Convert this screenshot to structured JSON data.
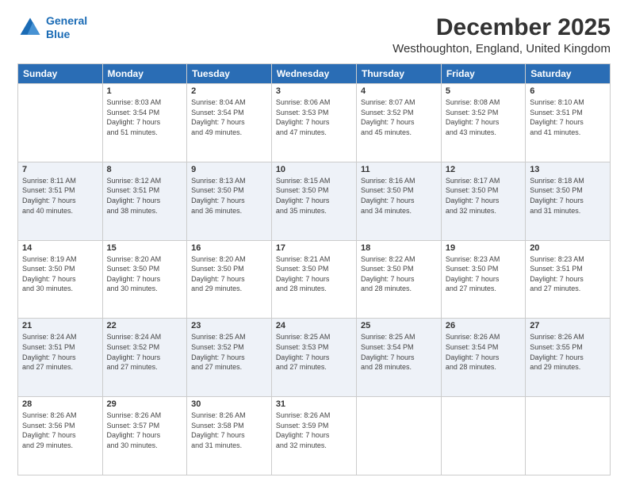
{
  "logo": {
    "line1": "General",
    "line2": "Blue"
  },
  "title": "December 2025",
  "subtitle": "Westhoughton, England, United Kingdom",
  "days_of_week": [
    "Sunday",
    "Monday",
    "Tuesday",
    "Wednesday",
    "Thursday",
    "Friday",
    "Saturday"
  ],
  "weeks": [
    [
      {
        "day": "",
        "info": ""
      },
      {
        "day": "1",
        "info": "Sunrise: 8:03 AM\nSunset: 3:54 PM\nDaylight: 7 hours\nand 51 minutes."
      },
      {
        "day": "2",
        "info": "Sunrise: 8:04 AM\nSunset: 3:54 PM\nDaylight: 7 hours\nand 49 minutes."
      },
      {
        "day": "3",
        "info": "Sunrise: 8:06 AM\nSunset: 3:53 PM\nDaylight: 7 hours\nand 47 minutes."
      },
      {
        "day": "4",
        "info": "Sunrise: 8:07 AM\nSunset: 3:52 PM\nDaylight: 7 hours\nand 45 minutes."
      },
      {
        "day": "5",
        "info": "Sunrise: 8:08 AM\nSunset: 3:52 PM\nDaylight: 7 hours\nand 43 minutes."
      },
      {
        "day": "6",
        "info": "Sunrise: 8:10 AM\nSunset: 3:51 PM\nDaylight: 7 hours\nand 41 minutes."
      }
    ],
    [
      {
        "day": "7",
        "info": "Sunrise: 8:11 AM\nSunset: 3:51 PM\nDaylight: 7 hours\nand 40 minutes."
      },
      {
        "day": "8",
        "info": "Sunrise: 8:12 AM\nSunset: 3:51 PM\nDaylight: 7 hours\nand 38 minutes."
      },
      {
        "day": "9",
        "info": "Sunrise: 8:13 AM\nSunset: 3:50 PM\nDaylight: 7 hours\nand 36 minutes."
      },
      {
        "day": "10",
        "info": "Sunrise: 8:15 AM\nSunset: 3:50 PM\nDaylight: 7 hours\nand 35 minutes."
      },
      {
        "day": "11",
        "info": "Sunrise: 8:16 AM\nSunset: 3:50 PM\nDaylight: 7 hours\nand 34 minutes."
      },
      {
        "day": "12",
        "info": "Sunrise: 8:17 AM\nSunset: 3:50 PM\nDaylight: 7 hours\nand 32 minutes."
      },
      {
        "day": "13",
        "info": "Sunrise: 8:18 AM\nSunset: 3:50 PM\nDaylight: 7 hours\nand 31 minutes."
      }
    ],
    [
      {
        "day": "14",
        "info": "Sunrise: 8:19 AM\nSunset: 3:50 PM\nDaylight: 7 hours\nand 30 minutes."
      },
      {
        "day": "15",
        "info": "Sunrise: 8:20 AM\nSunset: 3:50 PM\nDaylight: 7 hours\nand 30 minutes."
      },
      {
        "day": "16",
        "info": "Sunrise: 8:20 AM\nSunset: 3:50 PM\nDaylight: 7 hours\nand 29 minutes."
      },
      {
        "day": "17",
        "info": "Sunrise: 8:21 AM\nSunset: 3:50 PM\nDaylight: 7 hours\nand 28 minutes."
      },
      {
        "day": "18",
        "info": "Sunrise: 8:22 AM\nSunset: 3:50 PM\nDaylight: 7 hours\nand 28 minutes."
      },
      {
        "day": "19",
        "info": "Sunrise: 8:23 AM\nSunset: 3:50 PM\nDaylight: 7 hours\nand 27 minutes."
      },
      {
        "day": "20",
        "info": "Sunrise: 8:23 AM\nSunset: 3:51 PM\nDaylight: 7 hours\nand 27 minutes."
      }
    ],
    [
      {
        "day": "21",
        "info": "Sunrise: 8:24 AM\nSunset: 3:51 PM\nDaylight: 7 hours\nand 27 minutes."
      },
      {
        "day": "22",
        "info": "Sunrise: 8:24 AM\nSunset: 3:52 PM\nDaylight: 7 hours\nand 27 minutes."
      },
      {
        "day": "23",
        "info": "Sunrise: 8:25 AM\nSunset: 3:52 PM\nDaylight: 7 hours\nand 27 minutes."
      },
      {
        "day": "24",
        "info": "Sunrise: 8:25 AM\nSunset: 3:53 PM\nDaylight: 7 hours\nand 27 minutes."
      },
      {
        "day": "25",
        "info": "Sunrise: 8:25 AM\nSunset: 3:54 PM\nDaylight: 7 hours\nand 28 minutes."
      },
      {
        "day": "26",
        "info": "Sunrise: 8:26 AM\nSunset: 3:54 PM\nDaylight: 7 hours\nand 28 minutes."
      },
      {
        "day": "27",
        "info": "Sunrise: 8:26 AM\nSunset: 3:55 PM\nDaylight: 7 hours\nand 29 minutes."
      }
    ],
    [
      {
        "day": "28",
        "info": "Sunrise: 8:26 AM\nSunset: 3:56 PM\nDaylight: 7 hours\nand 29 minutes."
      },
      {
        "day": "29",
        "info": "Sunrise: 8:26 AM\nSunset: 3:57 PM\nDaylight: 7 hours\nand 30 minutes."
      },
      {
        "day": "30",
        "info": "Sunrise: 8:26 AM\nSunset: 3:58 PM\nDaylight: 7 hours\nand 31 minutes."
      },
      {
        "day": "31",
        "info": "Sunrise: 8:26 AM\nSunset: 3:59 PM\nDaylight: 7 hours\nand 32 minutes."
      },
      {
        "day": "",
        "info": ""
      },
      {
        "day": "",
        "info": ""
      },
      {
        "day": "",
        "info": ""
      }
    ]
  ]
}
